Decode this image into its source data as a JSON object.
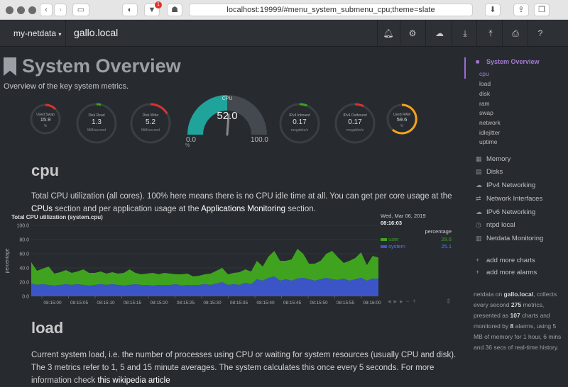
{
  "browser": {
    "url": "localhost:19999/#menu_system_submenu_cpu;theme=slate",
    "badge_count": "1"
  },
  "navbar": {
    "brand": "my-netdata",
    "host": "gallo.local"
  },
  "page": {
    "title": "System Overview",
    "subtitle": "Overview of the key system metrics."
  },
  "gauges": [
    {
      "title": "Used Swap",
      "value": "15.9",
      "unit": "%"
    },
    {
      "title": "Disk Read",
      "value": "1.3",
      "unit": "MiB/second"
    },
    {
      "title": "Disk Write",
      "value": "5.2",
      "unit": "MiB/second"
    },
    {
      "title": "IPv4 Inbound",
      "value": "0.17",
      "unit": "megabits/s"
    },
    {
      "title": "IPv4 Outbound",
      "value": "0.17",
      "unit": "megabits/s"
    },
    {
      "title": "Used RAM",
      "value": "59.6",
      "unit": "%"
    }
  ],
  "cpu_gauge": {
    "title": "CPU",
    "value": "52.0",
    "min": "0.0",
    "max": "100.0",
    "unit": "%"
  },
  "cpu_section": {
    "heading": "cpu",
    "text1": "Total CPU utilization (all cores). 100% here means there is no CPU idle time at all. You can get per core usage at the ",
    "link1": "CPUs",
    "text2": " section and per application usage at the ",
    "link2": "Applications Monitoring",
    "text3": " section."
  },
  "load_section": {
    "heading": "load",
    "text1": "Current system load, i.e. the number of processes using CPU or waiting for system resources (usually CPU and disk). The 3 metrics refer to 1, 5 and 15 minute averages. The system calculates this once every 5 seconds. For more information check ",
    "link1": "this wikipedia article"
  },
  "chart_data": {
    "type": "area",
    "title": "Total CPU utilization (system.cpu)",
    "ylabel": "percentage",
    "ylim": [
      0,
      100
    ],
    "yticks": [
      "100.0",
      "80.0",
      "60.0",
      "40.0",
      "20.0",
      "0.0"
    ],
    "xticks": [
      "08:15:00",
      "08:15:05",
      "08:15:10",
      "08:15:15",
      "08:15:20",
      "08:15:25",
      "08:15:30",
      "08:15:35",
      "08:15:40",
      "08:15:45",
      "08:15:50",
      "08:15:55",
      "08:16:00"
    ],
    "legend_date": "Wed, Mar 06, 2019",
    "legend_time": "08:16:03",
    "legend_unit": "percentage",
    "series": [
      {
        "name": "system",
        "color": "#3b55c7",
        "values": [
          18,
          16,
          17,
          16,
          15,
          16,
          17,
          16,
          17,
          16,
          15,
          16,
          17,
          16,
          17,
          16,
          15,
          16,
          17,
          16,
          16,
          15,
          16,
          16,
          16,
          17,
          15,
          16,
          16,
          16,
          17,
          16,
          18,
          20,
          16,
          17,
          16,
          19,
          17,
          24,
          22,
          26,
          28,
          22,
          24,
          22,
          25,
          26,
          24,
          22,
          24,
          26,
          24,
          23,
          25,
          22,
          24,
          26,
          22,
          25,
          25
        ]
      },
      {
        "name": "user",
        "color": "#3fa31f",
        "values": [
          30,
          20,
          22,
          26,
          17,
          18,
          20,
          17,
          18,
          22,
          18,
          17,
          18,
          16,
          17,
          16,
          18,
          22,
          16,
          15,
          16,
          18,
          15,
          17,
          16,
          14,
          16,
          16,
          12,
          13,
          14,
          16,
          18,
          20,
          15,
          16,
          18,
          19,
          18,
          26,
          20,
          30,
          36,
          28,
          26,
          30,
          42,
          34,
          22,
          24,
          26,
          34,
          40,
          32,
          22,
          28,
          30,
          36,
          22,
          32,
          29.6
        ]
      }
    ],
    "current": {
      "user": "29.6",
      "system": "25.1"
    }
  },
  "sidebar": {
    "title": "System Overview",
    "subitems": [
      "cpu",
      "load",
      "disk",
      "ram",
      "swap",
      "network",
      "idlejitter",
      "uptime"
    ],
    "sections": [
      {
        "icon": "memory-icon",
        "label": "Memory"
      },
      {
        "icon": "disks-icon",
        "label": "Disks"
      },
      {
        "icon": "network-icon",
        "label": "IPv4 Networking"
      },
      {
        "icon": "interfaces-icon",
        "label": "Network Interfaces"
      },
      {
        "icon": "network-icon",
        "label": "IPv6 Networking"
      },
      {
        "icon": "clock-icon",
        "label": "ntpd local"
      },
      {
        "icon": "monitoring-icon",
        "label": "Netdata Monitoring"
      }
    ],
    "add_charts": "add more charts",
    "add_alarms": "add more alarms",
    "footer": {
      "p1": "netdata on ",
      "host": "gallo.local",
      "p2": ", collects every second ",
      "metrics": "275",
      "p3": " metrics, presented as ",
      "charts": "107",
      "p4": " charts and monitored by ",
      "alarms": "8",
      "p5": " alarms, using 5 MB of memory for 1 hour, 6 mins and 36 secs of real-time history."
    }
  }
}
